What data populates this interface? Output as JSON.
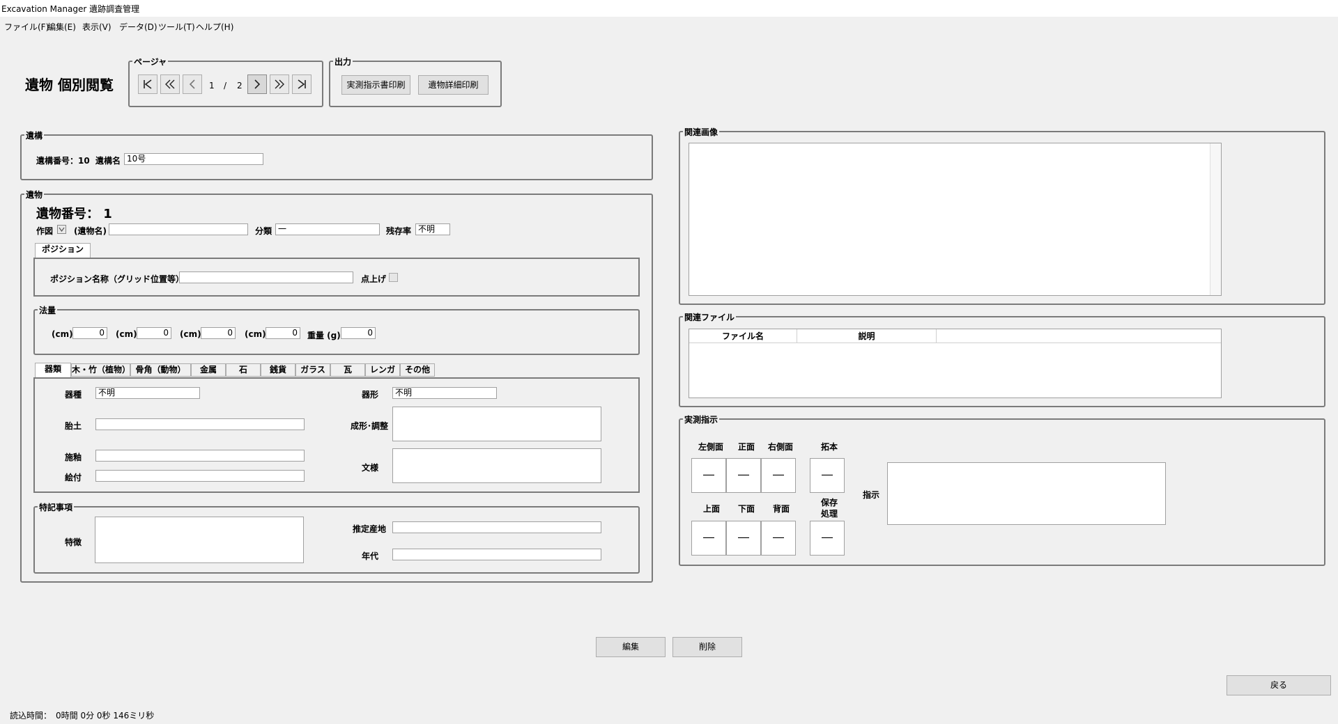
{
  "window": {
    "title": "Excavation Manager 遺跡調査管理"
  },
  "menu": [
    "ファイル(F)",
    "編集(E)",
    "表示(V)",
    "データ(D)",
    "ツール(T)",
    "ヘルプ(H)"
  ],
  "page": {
    "title": "遺物 個別閲覧"
  },
  "pager": {
    "legend": "ページャ",
    "current": "1",
    "sep": "/",
    "total": "2"
  },
  "output": {
    "legend": "出力",
    "print_instruction": "実測指示書印刷",
    "print_detail": "遺物詳細印刷"
  },
  "iko": {
    "legend": "遺構",
    "number_label": "遺構番号：10",
    "name_label": "遺構名",
    "name_value": "10号"
  },
  "ibutsu": {
    "legend": "遺物",
    "number_label": "遺物番号： 1",
    "drawing_label": "作図",
    "name_label": "(遺物名)",
    "name_value": "",
    "category_label": "分類",
    "category_value": "一",
    "remain_label": "残存率",
    "remain_value": "不明",
    "position_tab": "ポジション",
    "position_label": "ポジション名称（グリッド位置等）",
    "position_value": "",
    "point_label": "点上げ"
  },
  "measure": {
    "legend": "法量",
    "fields": [
      {
        "label": "(cm)",
        "value": "0"
      },
      {
        "label": "(cm)",
        "value": "0"
      },
      {
        "label": "(cm)",
        "value": "0"
      },
      {
        "label": "(cm)",
        "value": "0"
      },
      {
        "label": "重量 (g)",
        "value": "0"
      }
    ]
  },
  "tabs": [
    "器類",
    "木・竹（植物）",
    "骨角（動物）",
    "金属",
    "石",
    "銭貨",
    "ガラス",
    "瓦",
    "レンガ",
    "その他"
  ],
  "pottery": {
    "type_label": "器種",
    "type_value": "不明",
    "shape_label": "器形",
    "shape_value": "不明",
    "clay_label": "胎土",
    "forming_label": "成形･調整",
    "glaze_label": "施釉",
    "painting_label": "絵付",
    "pattern_label": "文様"
  },
  "notes": {
    "legend": "特記事項",
    "feature_label": "特徴",
    "origin_label": "推定産地",
    "era_label": "年代"
  },
  "images": {
    "legend": "関連画像"
  },
  "files": {
    "legend": "関連ファイル",
    "columns": [
      "ファイル名",
      "説明"
    ]
  },
  "instruction": {
    "legend": "実測指示",
    "left_side": "左側面",
    "front": "正面",
    "right_side": "右側面",
    "rubbing": "拓本",
    "top": "上面",
    "bottom": "下面",
    "back": "背面",
    "conservation": "保存\n処理",
    "dash": "―",
    "instr_label": "指示"
  },
  "buttons": {
    "edit": "編集",
    "delete": "削除",
    "back": "戻る"
  },
  "status": {
    "load_time": "読込時間：　0時間 0分 0秒 146ミリ秒"
  }
}
